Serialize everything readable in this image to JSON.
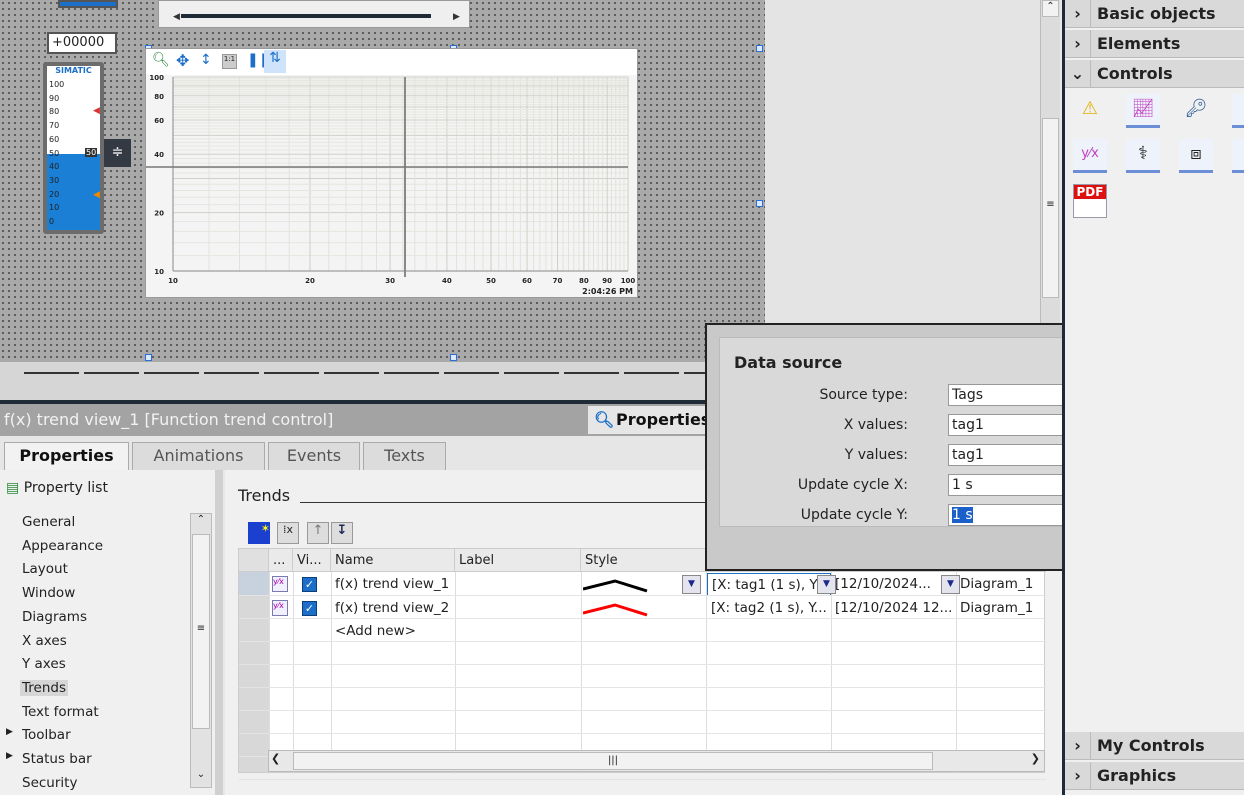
{
  "canvas": {
    "io_field_value": "+00000",
    "gauge": {
      "brand": "SIMATIC",
      "scale": [
        "100",
        "90",
        "80",
        "70",
        "60",
        "50",
        "40",
        "30",
        "20",
        "10",
        "0"
      ],
      "value": 50,
      "value_label": "50"
    },
    "trend_control": {
      "toolbar_icons": [
        "zoom-icon",
        "pan-icon",
        "zoom-y-icon",
        "original-view-icon",
        "pause-icon",
        "ruler-icon"
      ],
      "y_ticks": [
        "100",
        "80",
        "60",
        "40",
        "20",
        "10"
      ],
      "x_ticks": [
        "10",
        "20",
        "30",
        "40",
        "50",
        "60",
        "70",
        "80",
        "90",
        "100"
      ],
      "x_scale": "log",
      "y_scale": "log",
      "xlim": [
        10,
        100
      ],
      "ylim": [
        10,
        100
      ],
      "time": "2:04:26 PM"
    }
  },
  "inspector": {
    "title": "f(x) trend view_1 [Function trend control]",
    "properties_button": "Properties",
    "tabs": [
      "Properties",
      "Animations",
      "Events",
      "Texts"
    ],
    "active_tab": "Properties",
    "property_list": "Property list",
    "nav": [
      "General",
      "Appearance",
      "Layout",
      "Window",
      "Diagrams",
      "X axes",
      "Y axes",
      "Trends",
      "Text format",
      "Toolbar",
      "Status bar",
      "Security"
    ],
    "selected_nav": "Trends",
    "section_title": "Trends",
    "table": {
      "headers": [
        "...",
        "Vi...",
        "Name",
        "Label",
        "Style",
        "",
        "",
        ""
      ],
      "rows": [
        {
          "visible": true,
          "name": "f(x) trend view_1",
          "label": "",
          "style_color": "#000000",
          "source": "[X: tag1 (1 s), Y",
          "time": "[12/10/2024...",
          "diagram": "Diagram_1"
        },
        {
          "visible": true,
          "name": "f(x) trend view_2",
          "label": "",
          "style_color": "#ff0000",
          "source": "[X: tag2 (1 s), Y...",
          "time": "[12/10/2024 12...",
          "diagram": "Diagram_1"
        }
      ],
      "add_new": "<Add new>"
    }
  },
  "dialog": {
    "title": "Data source",
    "fields": [
      {
        "label": "Source type:",
        "value": "Tags"
      },
      {
        "label": "X values:",
        "value": "tag1"
      },
      {
        "label": "Y values:",
        "value": "tag1"
      },
      {
        "label": "Update cycle X:",
        "value": "1 s"
      },
      {
        "label": "Update cycle Y:",
        "value": "1 s"
      }
    ],
    "ok": "✔",
    "cancel": "✖"
  },
  "toolbox": {
    "sections": [
      "Basic objects",
      "Elements",
      "Controls",
      "My Controls",
      "Graphics"
    ],
    "controls": [
      "alarm-view-icon",
      "trend-view-icon",
      "user-view-icon",
      "html-browser-icon",
      "function-trend-icon",
      "diagnostics-icon",
      "plc-code-view-icon",
      "recipe-view-icon",
      "pdf-view-icon"
    ],
    "pdf_label": "PDF"
  }
}
